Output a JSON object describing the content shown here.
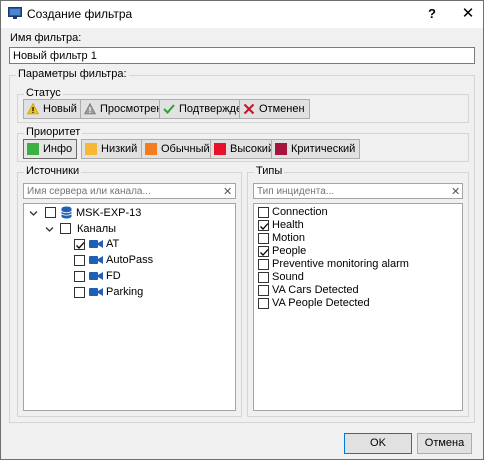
{
  "window": {
    "title": "Создание фильтра",
    "help_label": "?",
    "close_label": "✕"
  },
  "name": {
    "label": "Имя фильтра:",
    "value": "Новый фильтр 1"
  },
  "params": {
    "label": "Параметры фильтра:"
  },
  "status": {
    "label": "Статус",
    "items": [
      {
        "label": "Новый",
        "icon": "warning-yellow-icon"
      },
      {
        "label": "Просмотрен",
        "icon": "warning-gray-icon"
      },
      {
        "label": "Подтвержден",
        "icon": "check-icon"
      },
      {
        "label": "Отменен",
        "icon": "cross-icon"
      }
    ]
  },
  "priority": {
    "label": "Приоритет",
    "items": [
      {
        "label": "Инфо",
        "color": "#3cb043",
        "selected": true
      },
      {
        "label": "Низкий",
        "color": "#f7b731"
      },
      {
        "label": "Обычный",
        "color": "#f47c20"
      },
      {
        "label": "Высокий",
        "color": "#e8102a"
      },
      {
        "label": "Критический",
        "color": "#a3153c"
      }
    ]
  },
  "sources": {
    "label": "Источники",
    "placeholder": "Имя сервера или канала...",
    "clear_label": "✕",
    "server": "MSK-EXP-13",
    "group": "Каналы",
    "channels": [
      {
        "label": "AT",
        "checked": true
      },
      {
        "label": "AutoPass",
        "checked": false
      },
      {
        "label": "FD",
        "checked": false
      },
      {
        "label": "Parking",
        "checked": false
      }
    ]
  },
  "types": {
    "label": "Типы",
    "placeholder": "Тип инцидента...",
    "clear_label": "✕",
    "items": [
      {
        "label": "Connection",
        "checked": false
      },
      {
        "label": "Health",
        "checked": true
      },
      {
        "label": "Motion",
        "checked": false
      },
      {
        "label": "People",
        "checked": true
      },
      {
        "label": "Preventive monitoring alarm",
        "checked": false
      },
      {
        "label": "Sound",
        "checked": false
      },
      {
        "label": "VA Cars Detected",
        "checked": false
      },
      {
        "label": "VA People Detected",
        "checked": false
      }
    ]
  },
  "buttons": {
    "ok": "OK",
    "cancel": "Отмена"
  }
}
